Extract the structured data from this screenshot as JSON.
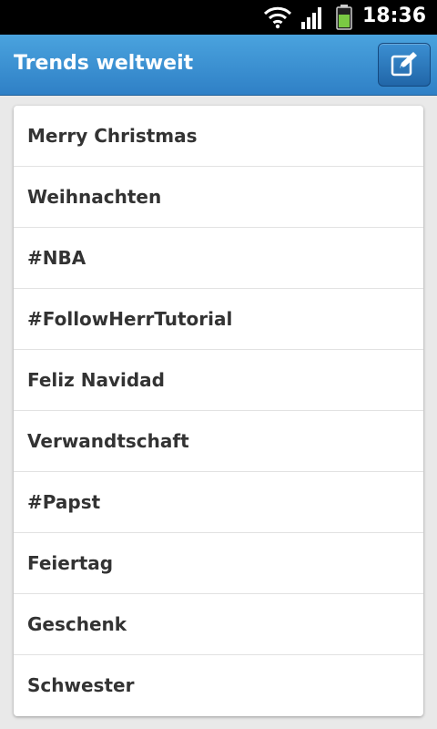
{
  "status_bar": {
    "time": "18:36",
    "icons": [
      "wifi-icon",
      "signal-icon",
      "battery-icon"
    ],
    "battery_color": "#7ac943"
  },
  "action_bar": {
    "title": "Trends weltweit",
    "compose_icon": "compose-icon",
    "accent_color": "#2f80c6"
  },
  "trends": [
    {
      "label": "Merry Christmas"
    },
    {
      "label": "Weihnachten"
    },
    {
      "label": "#NBA"
    },
    {
      "label": "#FollowHerrTutorial"
    },
    {
      "label": "Feliz Navidad"
    },
    {
      "label": "Verwandtschaft"
    },
    {
      "label": "#Papst"
    },
    {
      "label": "Feiertag"
    },
    {
      "label": "Geschenk"
    },
    {
      "label": "Schwester"
    }
  ]
}
